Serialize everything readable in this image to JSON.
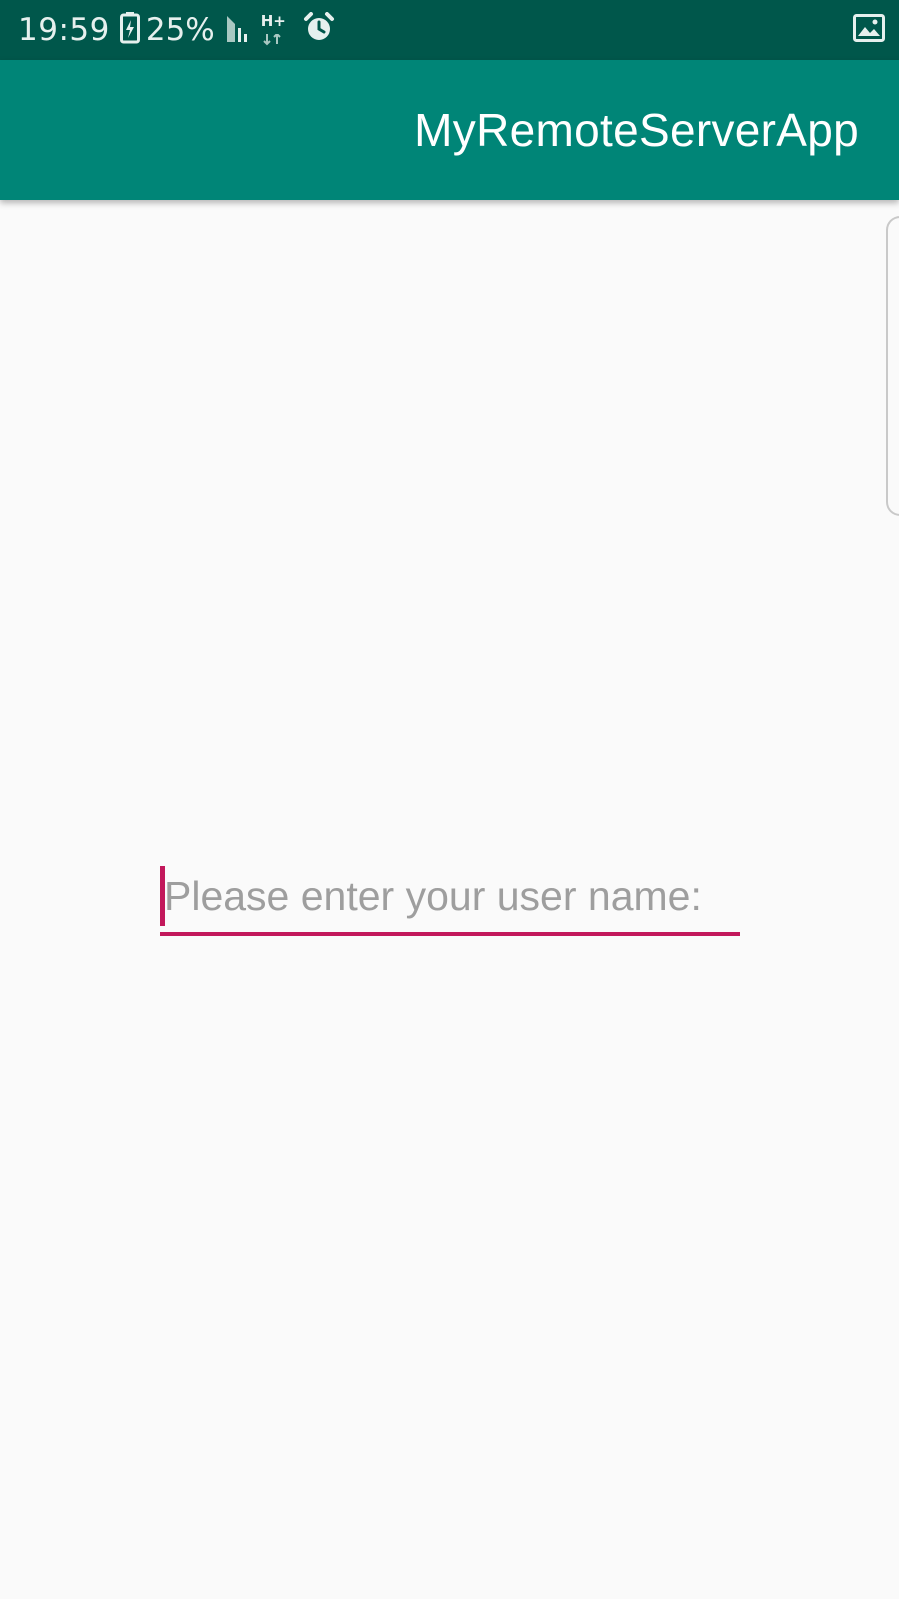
{
  "status_bar": {
    "time": "19:59",
    "battery_percent": "25%",
    "network_type": "H+",
    "icons": [
      "battery-charging-icon",
      "signal-icon",
      "network-hplus-icon",
      "alarm-icon",
      "image-notification-icon"
    ]
  },
  "app_bar": {
    "title": "MyRemoteServerApp",
    "background_color": "#008577"
  },
  "username_field": {
    "value": "",
    "placeholder": "Please enter your user name:",
    "accent_color": "#c2185b"
  }
}
